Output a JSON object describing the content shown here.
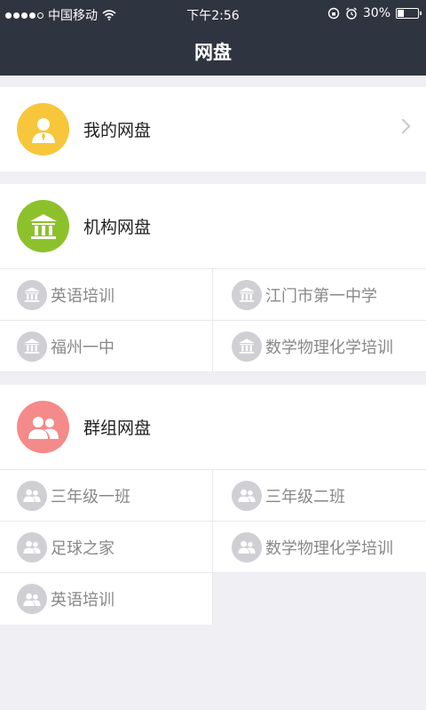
{
  "status": {
    "carrier": "中国移动",
    "time": "下午2:56",
    "battery": "30%",
    "battery_level": 0.3
  },
  "header": {
    "title": "网盘"
  },
  "my_drive": {
    "label": "我的网盘",
    "color": "#f7c63a"
  },
  "org_drive": {
    "label": "机构网盘",
    "color": "#8dc12c",
    "items": [
      {
        "label": "英语培训"
      },
      {
        "label": "江门市第一中学"
      },
      {
        "label": "福州一中"
      },
      {
        "label": "数学物理化学培训"
      }
    ]
  },
  "group_drive": {
    "label": "群组网盘",
    "color": "#f58a8a",
    "items": [
      {
        "label": "三年级一班"
      },
      {
        "label": "三年级二班"
      },
      {
        "label": "足球之家"
      },
      {
        "label": "数学物理化学培训"
      },
      {
        "label": "英语培训"
      }
    ]
  }
}
